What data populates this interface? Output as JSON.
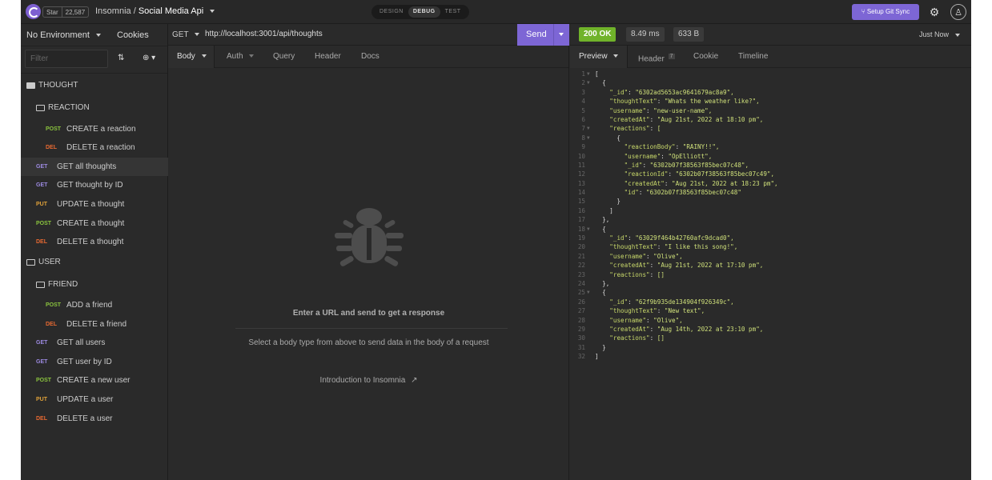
{
  "topbar": {
    "github_label": "Star",
    "github_count": "22,587",
    "app_name": "Insomnia",
    "separator": "/",
    "project_name": "Social Media Api",
    "modes": [
      "DESIGN",
      "DEBUG",
      "TEST"
    ],
    "active_mode": "DEBUG",
    "git_sync_label": "Setup Git Sync"
  },
  "sidebar": {
    "environment": "No Environment",
    "cookies": "Cookies",
    "filter_placeholder": "Filter",
    "items": [
      {
        "type": "folder",
        "label": "THOUGHT"
      },
      {
        "type": "folder",
        "label": "REACTION"
      },
      {
        "method": "POST",
        "label": "CREATE a reaction"
      },
      {
        "method": "DEL",
        "label": "DELETE a reaction"
      },
      {
        "method": "GET",
        "label": "GET all thoughts"
      },
      {
        "method": "GET",
        "label": "GET thought by ID"
      },
      {
        "method": "PUT",
        "label": "UPDATE a thought"
      },
      {
        "method": "POST",
        "label": "CREATE a thought"
      },
      {
        "method": "DEL",
        "label": "DELETE a thought"
      },
      {
        "type": "folder",
        "label": "USER"
      },
      {
        "type": "folder",
        "label": "FRIEND"
      },
      {
        "method": "POST",
        "label": "ADD a friend"
      },
      {
        "method": "DEL",
        "label": "DELETE a friend"
      },
      {
        "method": "GET",
        "label": "GET all users"
      },
      {
        "method": "GET",
        "label": "GET user by ID"
      },
      {
        "method": "POST",
        "label": "CREATE a new user"
      },
      {
        "method": "PUT",
        "label": "UPDATE a user"
      },
      {
        "method": "DEL",
        "label": "DELETE a user"
      }
    ]
  },
  "request": {
    "method": "GET",
    "url": "http://localhost:3001/api/thoughts",
    "send_label": "Send",
    "tabs": [
      "Body",
      "Auth",
      "Query",
      "Header",
      "Docs"
    ],
    "empty_title": "Enter a URL and send to get a response",
    "empty_subtitle": "Select a body type from above to send data in the body of a request",
    "intro_link": "Introduction to Insomnia"
  },
  "response": {
    "status": "200 OK",
    "time": "8.49 ms",
    "size": "633 B",
    "timestamp": "Just Now",
    "tabs": [
      "Preview",
      "Header",
      "Cookie",
      "Timeline"
    ],
    "header_count": "7",
    "lines": [
      "[",
      "  {",
      "    \"_id\": \"6302ad5653ac9641679ac8a9\",",
      "    \"thoughtText\": \"Whats the weather like?\",",
      "    \"username\": \"new-user-name\",",
      "    \"createdAt\": \"Aug 21st, 2022 at 18:10 pm\",",
      "    \"reactions\": [",
      "      {",
      "        \"reactionBody\": \"RAINY!!\",",
      "        \"username\": \"OpElliott\",",
      "        \"_id\": \"6302b07f38563f85bec07c48\",",
      "        \"reactionId\": \"6302b07f38563f85bec07c49\",",
      "        \"createdAt\": \"Aug 21st, 2022 at 18:23 pm\",",
      "        \"id\": \"6302b07f38563f85bec07c48\"",
      "      }",
      "    ]",
      "  },",
      "  {",
      "    \"_id\": \"63029f464b42760afc9dcad0\",",
      "    \"thoughtText\": \"I like this song!\",",
      "    \"username\": \"Olive\",",
      "    \"createdAt\": \"Aug 21st, 2022 at 17:10 pm\",",
      "    \"reactions\": []",
      "  },",
      "  {",
      "    \"_id\": \"62f9b935de134904f926349c\",",
      "    \"thoughtText\": \"New text\",",
      "    \"username\": \"Olive\",",
      "    \"createdAt\": \"Aug 14th, 2022 at 23:10 pm\",",
      "    \"reactions\": []",
      "  }",
      "]"
    ]
  }
}
